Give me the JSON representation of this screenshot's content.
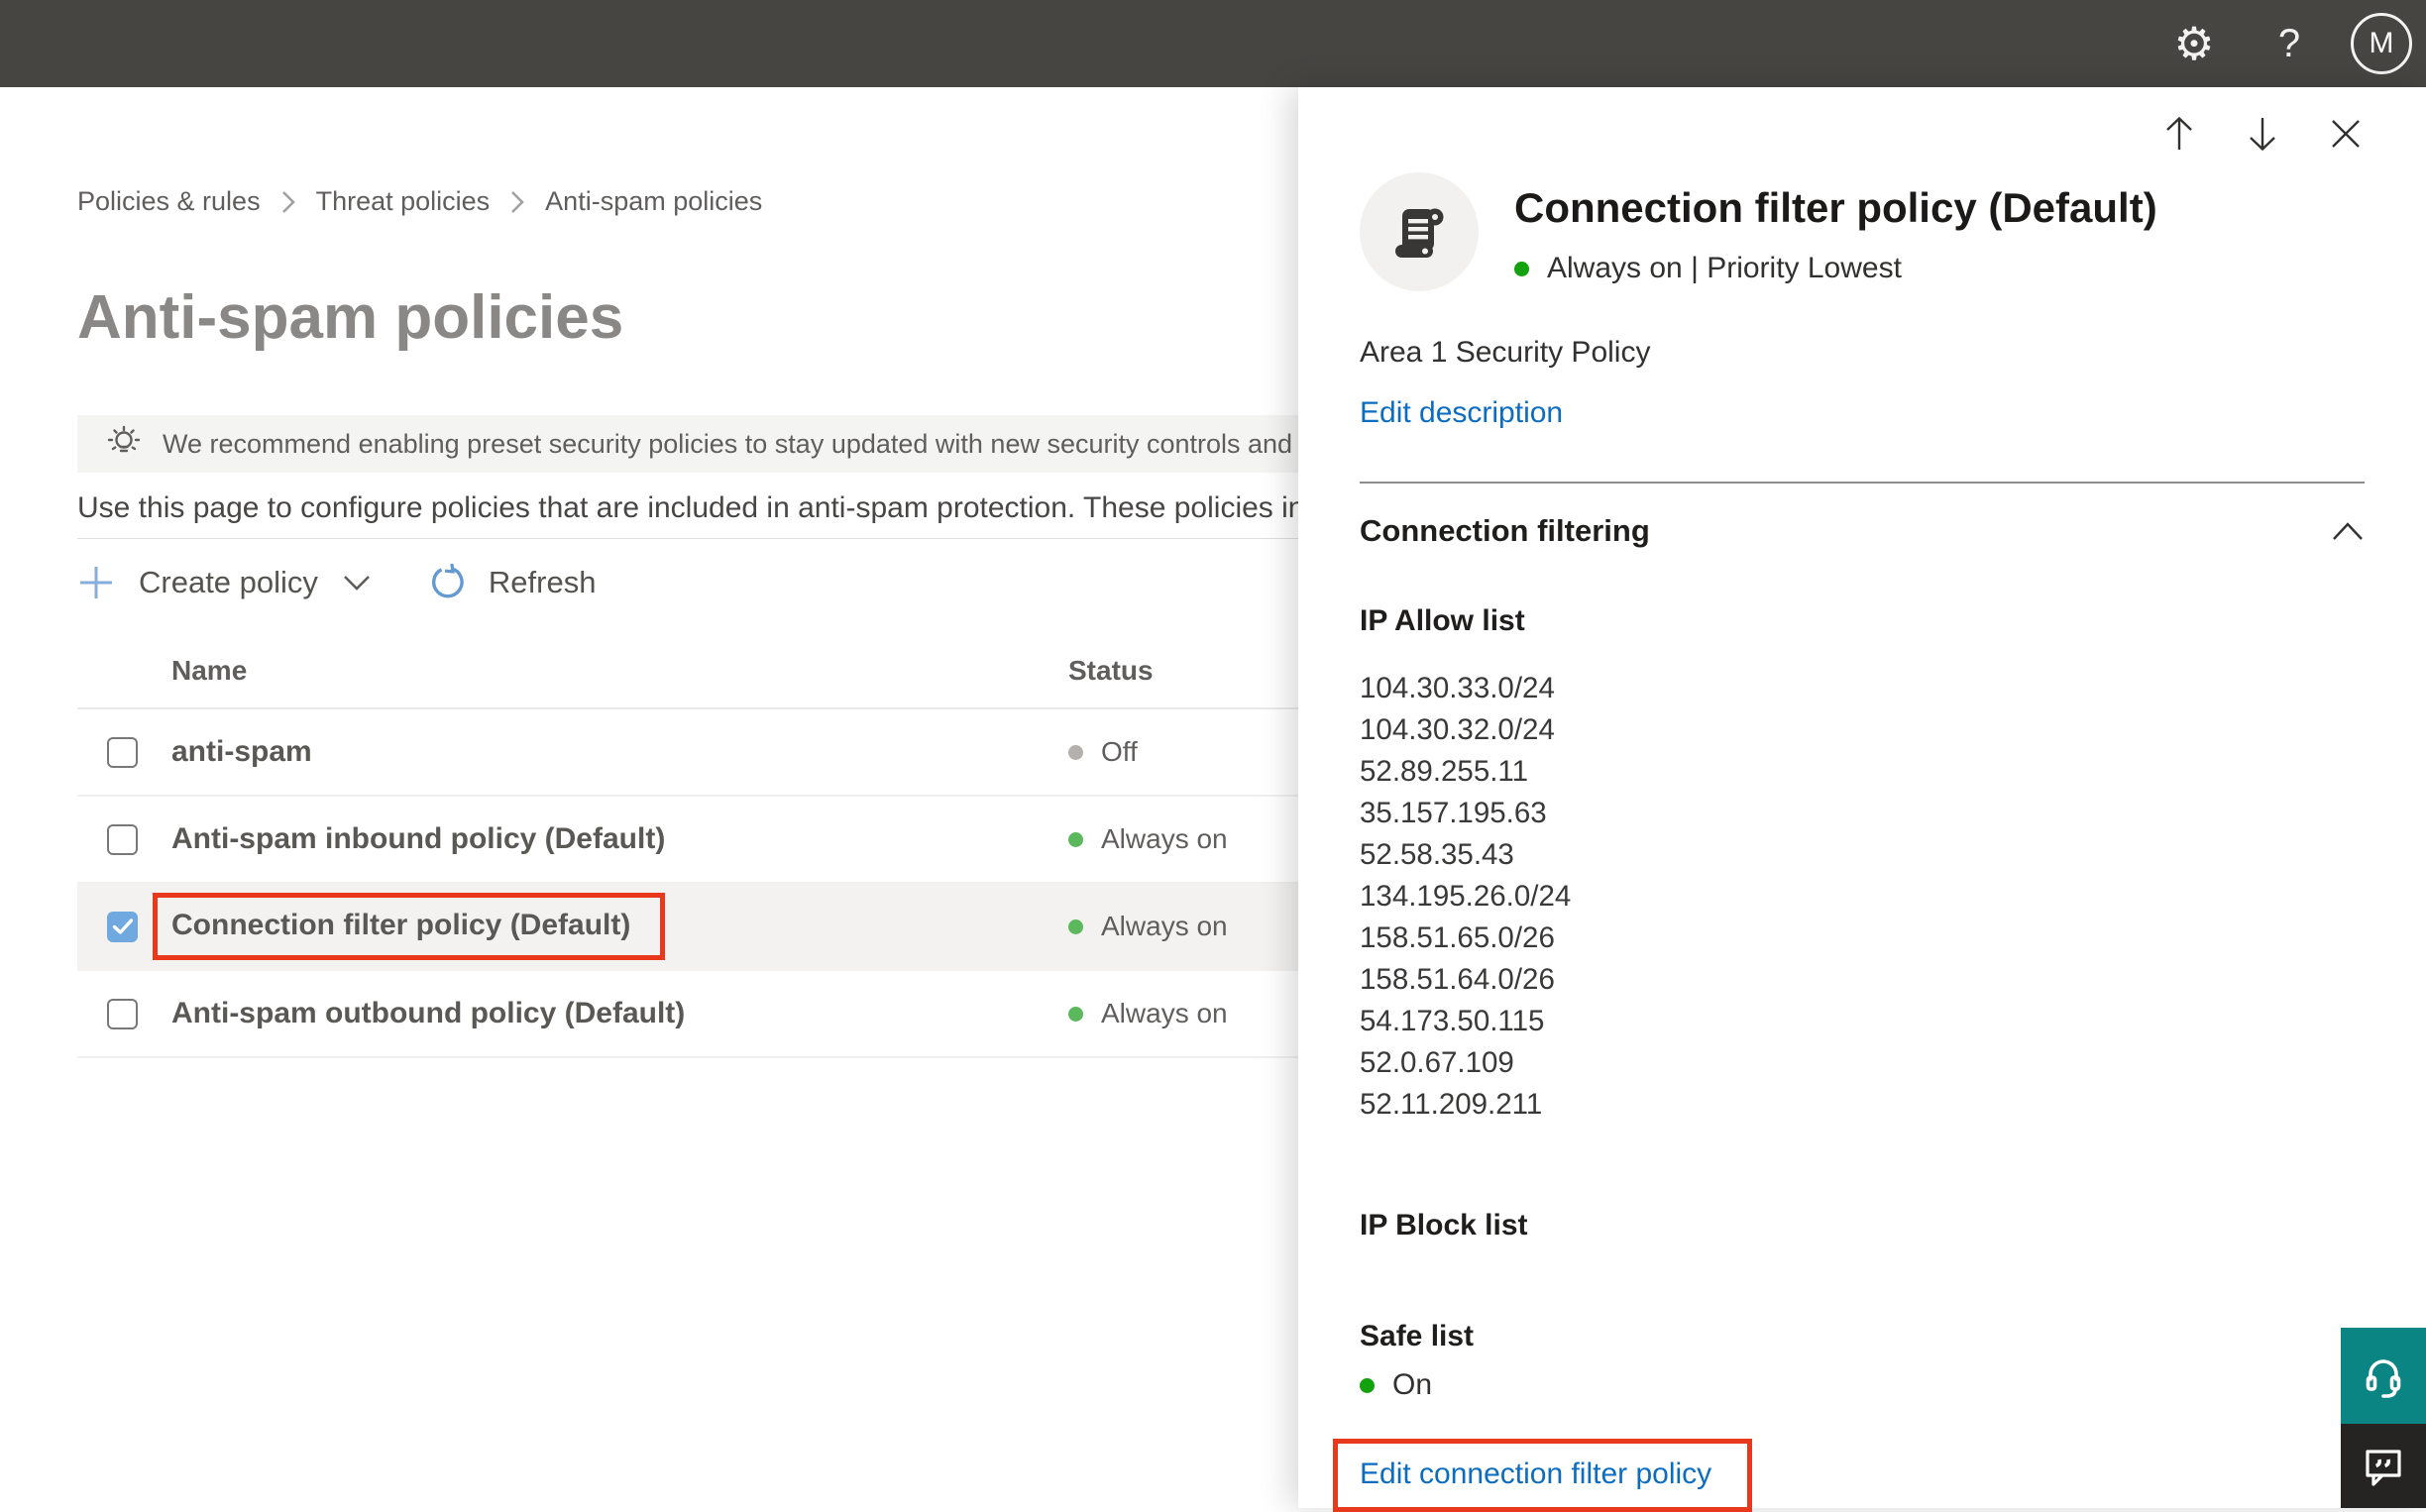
{
  "topbar": {
    "avatar_initial": "M"
  },
  "breadcrumb": {
    "items": [
      "Policies & rules",
      "Threat policies",
      "Anti-spam policies"
    ]
  },
  "page": {
    "title": "Anti-spam policies",
    "banner_text": "We recommend enabling preset security policies to stay updated with new security controls and our recomme",
    "description": "Use this page to configure policies that are included in anti-spam protection. These policies include",
    "toolbar": {
      "create_policy_label": "Create policy",
      "refresh_label": "Refresh"
    }
  },
  "table": {
    "columns": [
      "Name",
      "Status"
    ],
    "rows": [
      {
        "name": "anti-spam",
        "status": "Off",
        "checked": false,
        "selected": false
      },
      {
        "name": "Anti-spam inbound policy (Default)",
        "status": "Always on",
        "checked": false,
        "selected": false
      },
      {
        "name": "Connection filter policy (Default)",
        "status": "Always on",
        "checked": true,
        "selected": true,
        "annotated": true
      },
      {
        "name": "Anti-spam outbound policy (Default)",
        "status": "Always on",
        "checked": false,
        "selected": false
      }
    ]
  },
  "panel": {
    "title": "Connection filter policy (Default)",
    "status_line": "Always on | Priority Lowest",
    "description": "Area 1 Security Policy",
    "edit_description_label": "Edit description",
    "section_title": "Connection filtering",
    "ip_allow": {
      "title": "IP Allow list",
      "items": [
        "104.30.33.0/24",
        "104.30.32.0/24",
        "52.89.255.11",
        "35.157.195.63",
        "52.58.35.43",
        "134.195.26.0/24",
        "158.51.65.0/26",
        "158.51.64.0/26",
        "54.173.50.115",
        "52.0.67.109",
        "52.11.209.211"
      ]
    },
    "ip_block": {
      "title": "IP Block list"
    },
    "safe_list": {
      "title": "Safe list",
      "value": "On"
    },
    "edit_link_label": "Edit connection filter policy"
  },
  "icons": {
    "topbar": [
      "gear",
      "question-mark",
      "avatar-initial"
    ],
    "banner": "lightbulb",
    "toolbar": [
      "plus",
      "chevron-down",
      "refresh-circular-arrow"
    ],
    "panel_nav": [
      "arrow-up",
      "arrow-down",
      "close-x"
    ],
    "panel_avatar": "policy-scroll",
    "section": "chevron-up-collapse",
    "floating": [
      "headset-support",
      "feedback-speech-bubble"
    ]
  },
  "colors": {
    "topbar": "#464542",
    "link": "#0c6dc0",
    "accent": "#0078d4",
    "annotation_red": "#e8391d",
    "checkbox_blue": "#6fa9df",
    "green_table": "#5cb85c",
    "green_panel": "#13a10e",
    "gray_off": "#b3b0ad",
    "selected_bg": "#f3f2f1",
    "banner_bg": "#f4f4f3",
    "teal": "#0b8484",
    "feedback_dark": "#252423",
    "title_gray": "#8a8886"
  }
}
